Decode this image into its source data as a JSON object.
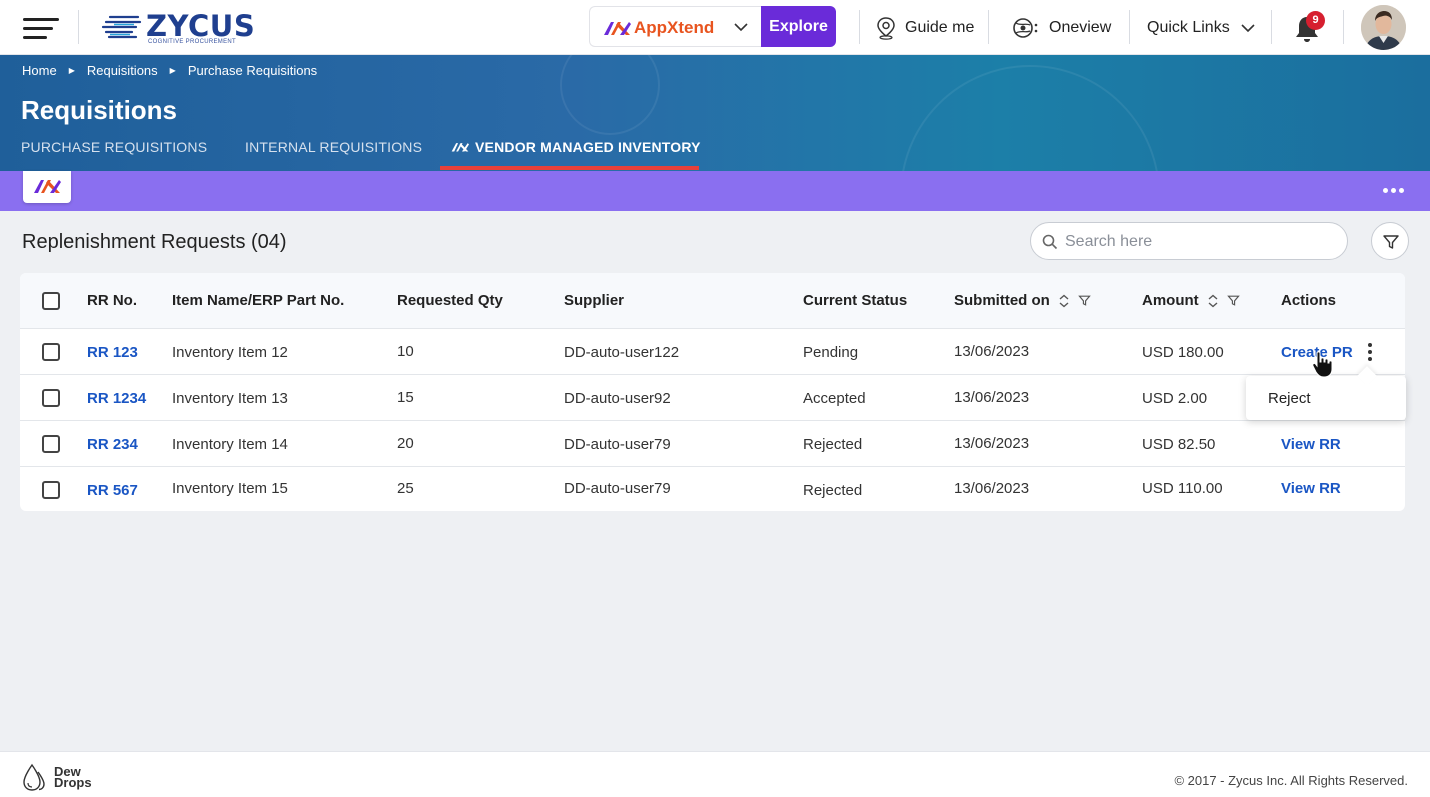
{
  "topbar": {
    "logo_text": "ZYCUS",
    "logo_subtitle": "COGNITIVE PROCUREMENT",
    "appxtend_label": "AppXtend",
    "explore_label": "Explore",
    "guide_label": "Guide me",
    "oneview_label": "Oneview",
    "quicklinks_label": "Quick Links",
    "notification_count": "9"
  },
  "breadcrumb": [
    "Home",
    "Requisitions",
    "Purchase Requisitions"
  ],
  "page_title": "Requisitions",
  "tabs": [
    {
      "label": "PURCHASE REQUISITIONS"
    },
    {
      "label": "INTERNAL REQUISITIONS"
    },
    {
      "label": "VENDOR MANAGED INVENTORY",
      "active": true
    }
  ],
  "section_title": "Replenishment Requests (04)",
  "search": {
    "placeholder": "Search here"
  },
  "table": {
    "headers": {
      "rr_no": "RR No.",
      "item": "Item Name/ERP Part No.",
      "qty": "Requested Qty",
      "supplier": "Supplier",
      "status": "Current Status",
      "submitted": "Submitted on",
      "amount": "Amount",
      "actions": "Actions"
    },
    "rows": [
      {
        "rr_no": "RR 123",
        "item": "Inventory Item 12",
        "qty": "10",
        "supplier": "DD-auto-user122",
        "status": "Pending",
        "submitted": "13/06/2023",
        "amount": "USD 180.00",
        "action": "Create PR"
      },
      {
        "rr_no": "RR 1234",
        "item": "Inventory Item 13",
        "qty": "15",
        "supplier": "DD-auto-user92",
        "status": "Accepted",
        "submitted": "13/06/2023",
        "amount": "USD 2.00",
        "action": ""
      },
      {
        "rr_no": "RR 234",
        "item": "Inventory Item 14",
        "qty": "20",
        "supplier": "DD-auto-user79",
        "status": "Rejected",
        "submitted": "13/06/2023",
        "amount": "USD 82.50",
        "action": "View RR"
      },
      {
        "rr_no": "RR 567",
        "item": "Inventory Item 15",
        "qty": "25",
        "supplier": "DD-auto-user79",
        "status": "Rejected",
        "submitted": "13/06/2023",
        "amount": "USD 110.00",
        "action": "View RR"
      }
    ]
  },
  "popover": {
    "reject_label": "Reject"
  },
  "footer": {
    "brand_line1": "Dew",
    "brand_line2": "Drops",
    "copyright": "© 2017 - Zycus Inc. All Rights Reserved."
  },
  "colors": {
    "explore_purple": "#6a2bd9",
    "appxtend_orange": "#e8541f",
    "banner_blue": "#2a6aa7",
    "strip_purple": "#8a6ff0",
    "link_blue": "#1a56c4",
    "tab_underline_red": "#e8403a",
    "badge_red": "#d61f2f"
  }
}
